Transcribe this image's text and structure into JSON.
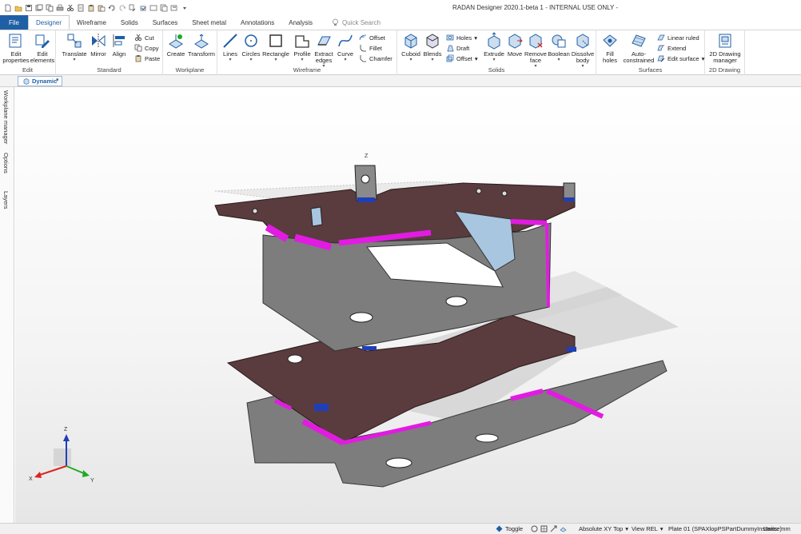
{
  "window": {
    "title": "RADAN Designer 2020.1-beta 1 - INTERNAL USE ONLY -"
  },
  "quick_access": [
    "new-icon",
    "open-icon",
    "save-icon",
    "save-all-icon",
    "copy-doc-icon",
    "print-icon",
    "cut-icon",
    "scissors-icon",
    "clipboard-icon",
    "paste-icon",
    "undo-icon",
    "redo-icon",
    "refresh-icon",
    "history-icon",
    "properties-icon",
    "import-icon",
    "export-icon",
    "customize-icon"
  ],
  "tabs": {
    "file": "File",
    "designer": "Designer",
    "wireframe": "Wireframe",
    "solids": "Solids",
    "surfaces": "Surfaces",
    "sheet_metal": "Sheet metal",
    "annotations": "Annotations",
    "analysis": "Analysis",
    "search_placeholder": "Quick Search"
  },
  "ribbon": {
    "edit": {
      "label": "Edit",
      "edit_properties": "Edit properties",
      "edit_elements": "Edit elements"
    },
    "standard": {
      "label": "Standard",
      "translate": "Translate",
      "mirror": "Mirror",
      "align": "Align",
      "cut": "Cut",
      "copy": "Copy",
      "paste": "Paste"
    },
    "workplane": {
      "label": "Workplane",
      "create": "Create",
      "transform": "Transform"
    },
    "wireframe": {
      "label": "Wireframe",
      "lines": "Lines",
      "circles": "Circles",
      "rectangle": "Rectangle",
      "profile": "Profile",
      "extract_edges": "Extract edges",
      "curve": "Curve",
      "offset": "Offset",
      "fillet": "Fillet",
      "chamfer": "Chamfer"
    },
    "solids": {
      "label": "Solids",
      "cuboid": "Cuboid",
      "blends": "Blends",
      "holes": "Holes",
      "draft": "Draft",
      "offset": "Offset",
      "extrude": "Extrude",
      "move": "Move",
      "remove_face": "Remove face",
      "boolean": "Boolean",
      "dissolve_body": "Dissolve body"
    },
    "surfaces": {
      "label": "Surfaces",
      "fill_holes": "Fill holes",
      "auto_constrained": "Auto-constrained",
      "linear_ruled": "Linear ruled",
      "extend": "Extend",
      "edit_surface": "Edit surface"
    },
    "drawing": {
      "label": "2D Drawing",
      "manager": "2D Drawing manager"
    }
  },
  "document": {
    "tab": "Dynamic"
  },
  "left_dock": {
    "workplane_manager": "Workplane manager",
    "options": "Options",
    "layers": "Layers"
  },
  "viewport": {
    "axis_z": "Z",
    "axis_x": "X",
    "axis_y": "Y"
  },
  "colors": {
    "accent": "#1f5fa6",
    "bend": "#e21be2",
    "metal_dark": "#5a3b3e",
    "metal_gray": "#8b8b8b",
    "tab_blue": "#1e3fb8"
  },
  "status": {
    "toggle": "Toggle",
    "absolute": "Absolute XY Top",
    "view": "View REL",
    "plate": "Plate 01 (SPAXlopPSPartDummyInstance)",
    "units": "Units: mm"
  }
}
